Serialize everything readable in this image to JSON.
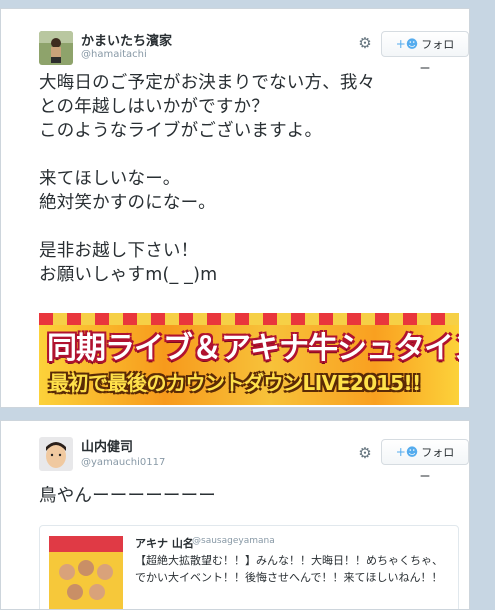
{
  "tweet1": {
    "display_name": "かまいたち濱家",
    "handle": "@hamaitachi",
    "follow_label": "フォロー",
    "text": "大晦日のご予定がお決まりでない方、我々\nとの年越しはいかがですか？\nこのようなライブがございますよ。\n\n来てほしいなー。\n絶対笑かすのになー。\n\n是非お越し下さい！\nお願いしゃすm(_ _)m",
    "banner": {
      "line1": "同期ライブ＆アキナ牛シュタイン!!",
      "line2": "最初で最後のカウントダウンLIVE2015!!"
    }
  },
  "tweet2": {
    "display_name": "山内健司",
    "handle": "@yamauchi0117",
    "follow_label": "フォロー",
    "text": "鳥やんーーーーーーー",
    "quoted": {
      "display_name": "アキナ 山名",
      "handle": "@sausageyamana",
      "text": "【超絶大拡散望む！！】みんな！！大晦日！！めちゃくちゃ、でかい大イベント！！後悔させへんで！！来てほしいねん！！"
    }
  },
  "icons": {
    "settings": "gear-icon",
    "follow": "person-plus-icon"
  }
}
